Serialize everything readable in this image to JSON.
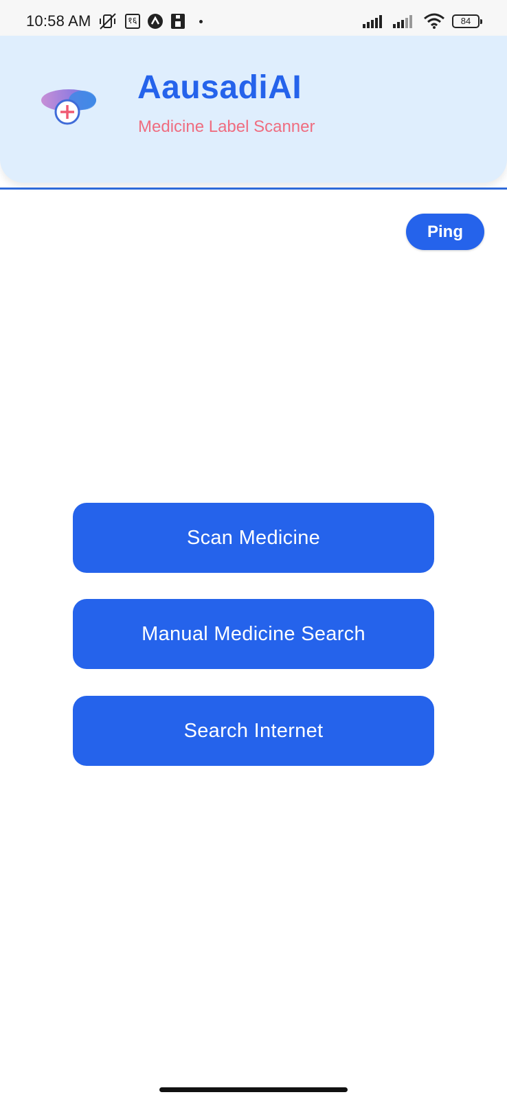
{
  "status_bar": {
    "time": "10:58 AM",
    "date_glyph": "१६",
    "battery": "84",
    "icons": [
      "vibrate-mute-icon",
      "calendar-date-icon",
      "app-a-icon",
      "sim-card-icon",
      "notification-dot-icon",
      "signal-icon",
      "signal-icon",
      "wifi-icon",
      "battery-icon"
    ]
  },
  "header": {
    "title": "AausadiAI",
    "subtitle": "Medicine Label Scanner",
    "logo_icon": "medicine-pill-plus-icon"
  },
  "ping": {
    "label": "Ping"
  },
  "actions": {
    "scan_label": "Scan Medicine",
    "manual_label": "Manual Medicine Search",
    "internet_label": "Search Internet"
  },
  "colors": {
    "primary": "#2563eb",
    "header_bg": "#dfeefd",
    "subtitle": "#ef6d80"
  }
}
